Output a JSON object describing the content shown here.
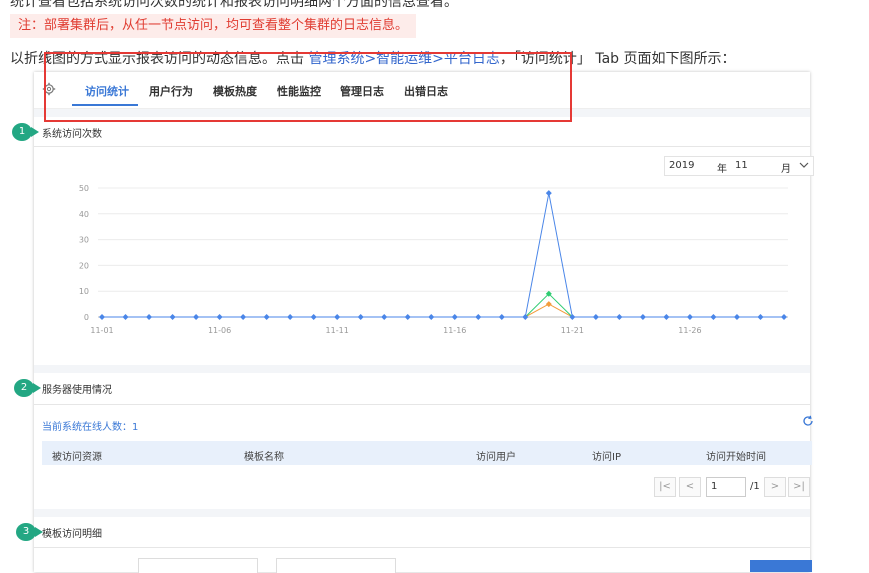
{
  "doc": {
    "top_cut_text": "统计查看包括系统访问次数的统计和报表访问明细两个方面的信息查看。",
    "note": "注：部署集群后，从任一节点访问，均可查看整个集群的日志信息。",
    "intro_before": "以折线图的方式显示报表访问的动态信息。点击 ",
    "intro_link": "管理系统>智能运维>平台日志",
    "intro_after": "，「访问统计」 Tab 页面如下图所示："
  },
  "tabs": [
    "访问统计",
    "用户行为",
    "模板热度",
    "性能监控",
    "管理日志",
    "出错日志"
  ],
  "active_tab": "访问统计",
  "badges": [
    "1",
    "2",
    "3"
  ],
  "section1": {
    "title": "系统访问次数",
    "date": {
      "year": "2019",
      "year_label": "年",
      "month": "11",
      "month_label": "月"
    }
  },
  "chart_data": {
    "type": "line",
    "x": [
      "11-01",
      "11-02",
      "11-03",
      "11-04",
      "11-05",
      "11-06",
      "11-07",
      "11-08",
      "11-09",
      "11-10",
      "11-11",
      "11-12",
      "11-13",
      "11-14",
      "11-15",
      "11-16",
      "11-17",
      "11-18",
      "11-19",
      "11-20",
      "11-21",
      "11-22",
      "11-23",
      "11-24",
      "11-25",
      "11-26",
      "11-27",
      "11-28",
      "11-29",
      "11-30"
    ],
    "x_tick_labels": [
      "11-01",
      "11-06",
      "11-11",
      "11-16",
      "11-21",
      "11-26"
    ],
    "y_ticks": [
      "0",
      "10",
      "20",
      "30",
      "40",
      "50"
    ],
    "ylim": [
      0,
      50
    ],
    "grid": true,
    "series": [
      {
        "color": "#4a86e8",
        "values": [
          0,
          0,
          0,
          0,
          0,
          0,
          0,
          0,
          0,
          0,
          0,
          0,
          0,
          0,
          0,
          0,
          0,
          0,
          0,
          48,
          0,
          0,
          0,
          0,
          0,
          0,
          0,
          0,
          0,
          0
        ]
      },
      {
        "color": "#2ecc71",
        "values": [
          0,
          0,
          0,
          0,
          0,
          0,
          0,
          0,
          0,
          0,
          0,
          0,
          0,
          0,
          0,
          0,
          0,
          0,
          0,
          9,
          0,
          0,
          0,
          0,
          0,
          0,
          0,
          0,
          0,
          0
        ]
      },
      {
        "color": "#f39c3c",
        "values": [
          0,
          0,
          0,
          0,
          0,
          0,
          0,
          0,
          0,
          0,
          0,
          0,
          0,
          0,
          0,
          0,
          0,
          0,
          0,
          5,
          0,
          0,
          0,
          0,
          0,
          0,
          0,
          0,
          0,
          0
        ]
      }
    ]
  },
  "section2": {
    "title": "服务器使用情况",
    "online": "当前系统在线人数：1",
    "columns": [
      "被访问资源",
      "模板名称",
      "访问用户",
      "访问IP",
      "访问开始时间"
    ],
    "pager": {
      "current": "1",
      "total": "/1"
    }
  },
  "section3": {
    "title": "模板访问明细"
  }
}
